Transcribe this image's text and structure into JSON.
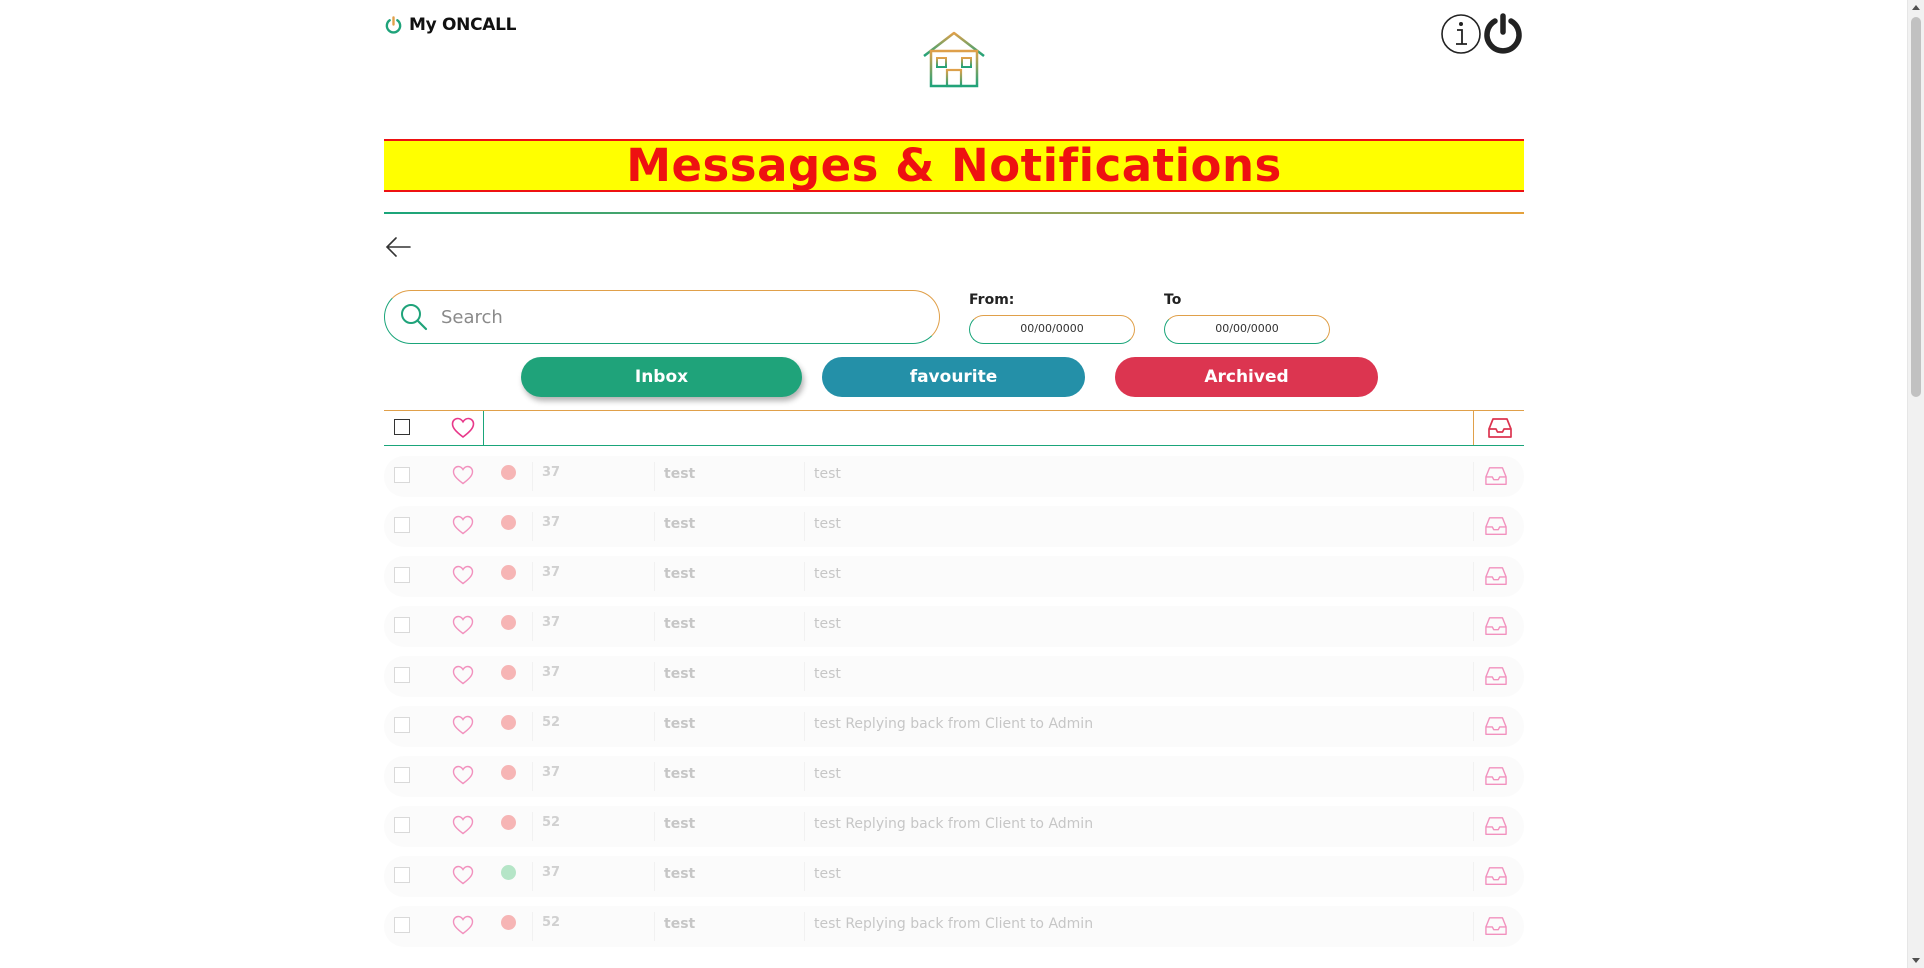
{
  "header": {
    "brand": "My ONCALL",
    "title": "Messages & Notifications"
  },
  "search": {
    "placeholder": "Search"
  },
  "filters": {
    "from_label": "From:",
    "from_value": "00/00/0000",
    "to_label": "To",
    "to_value": "00/00/0000"
  },
  "tabs": {
    "inbox": "Inbox",
    "favourite": "favourite",
    "archived": "Archived"
  },
  "colors": {
    "inbox": "#1fa37a",
    "favourite": "#2490a8",
    "archived": "#dc3550",
    "title_bg": "#ffff00",
    "title_text": "#ee1111",
    "unread_dot": "#f07a7a",
    "read_dot": "#7ad09a"
  },
  "icons": [
    "power-icon",
    "home-icon",
    "info-icon",
    "logout-icon",
    "back-arrow-icon",
    "search-icon",
    "heart-icon",
    "inbox-tray-icon"
  ],
  "messages": [
    {
      "id": "37",
      "subject": "test",
      "message": "test",
      "status": "unread"
    },
    {
      "id": "37",
      "subject": "test",
      "message": "test",
      "status": "unread"
    },
    {
      "id": "37",
      "subject": "test",
      "message": "test",
      "status": "unread"
    },
    {
      "id": "37",
      "subject": "test",
      "message": "test",
      "status": "unread"
    },
    {
      "id": "37",
      "subject": "test",
      "message": "test",
      "status": "unread"
    },
    {
      "id": "52",
      "subject": "test",
      "message": "test Replying back from Client to Admin",
      "status": "unread"
    },
    {
      "id": "37",
      "subject": "test",
      "message": "test",
      "status": "unread"
    },
    {
      "id": "52",
      "subject": "test",
      "message": "test Replying back from Client to Admin",
      "status": "unread"
    },
    {
      "id": "37",
      "subject": "test",
      "message": "test",
      "status": "read"
    },
    {
      "id": "52",
      "subject": "test",
      "message": "test Replying back from Client to Admin",
      "status": "unread"
    }
  ]
}
